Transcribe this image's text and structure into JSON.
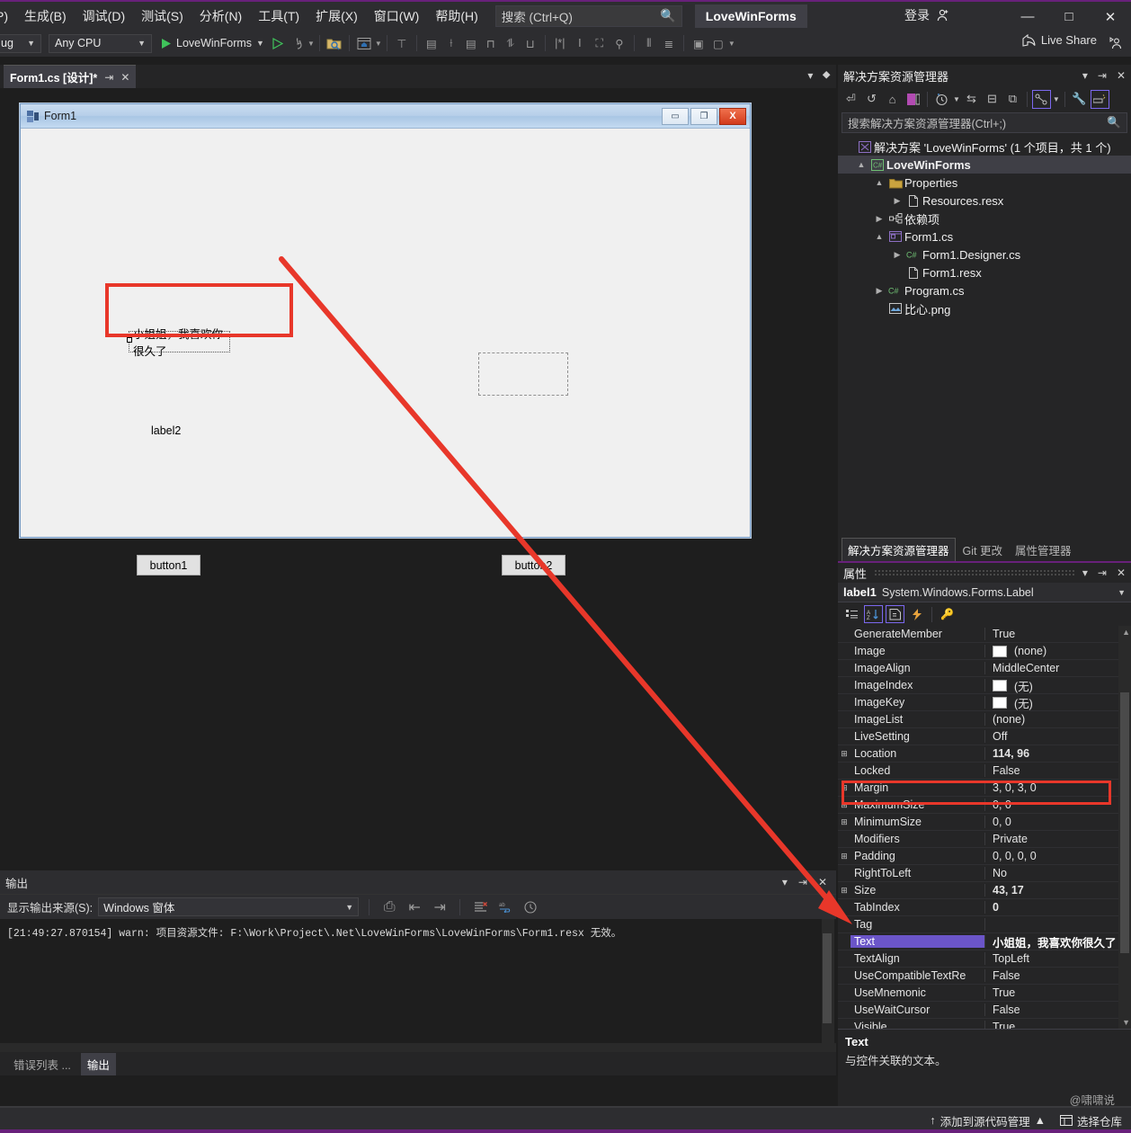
{
  "menu": {
    "items": [
      "P)",
      "生成(B)",
      "调试(D)",
      "测试(S)",
      "分析(N)",
      "工具(T)",
      "扩展(X)",
      "窗口(W)",
      "帮助(H)"
    ],
    "search_placeholder": "搜索 (Ctrl+Q)",
    "project_chip": "LoveWinForms",
    "login_label": "登录",
    "minimize": "—",
    "maximize": "□",
    "close": "✕"
  },
  "toolbar": {
    "config": "ug",
    "platform": "Any CPU",
    "run_target": "LoveWinForms",
    "live_share": "Live Share"
  },
  "doctab": {
    "title": "Form1.cs [设计]*",
    "pin": "⇥",
    "close": "✕"
  },
  "designer": {
    "form_title": "Form1",
    "minimize": "▭",
    "maximize": "❐",
    "close": "X",
    "label1_text": "小姐姐，我喜欢你很久了",
    "label2_text": "label2",
    "button1_text": "button1",
    "button2_text": "button2"
  },
  "solution_explorer": {
    "title": "解决方案资源管理器",
    "search_placeholder": "搜索解决方案资源管理器(Ctrl+;)",
    "tree": [
      {
        "indent": 0,
        "twisty": "",
        "icon": "solution-icon",
        "label": "解决方案 'LoveWinForms' (1 个项目，共 1 个)",
        "bold": false,
        "selected": false
      },
      {
        "indent": 1,
        "twisty": "▲",
        "icon": "csproj-icon",
        "label": "LoveWinForms",
        "bold": true,
        "selected": true
      },
      {
        "indent": 2,
        "twisty": "▲",
        "icon": "folder-icon",
        "label": "Properties",
        "bold": false,
        "selected": false
      },
      {
        "indent": 3,
        "twisty": "▶",
        "icon": "resx-icon",
        "label": "Resources.resx",
        "bold": false,
        "selected": false
      },
      {
        "indent": 2,
        "twisty": "▶",
        "icon": "deps-icon",
        "label": "依赖项",
        "bold": false,
        "selected": false
      },
      {
        "indent": 2,
        "twisty": "▲",
        "icon": "form-icon",
        "label": "Form1.cs",
        "bold": false,
        "selected": false
      },
      {
        "indent": 3,
        "twisty": "▶",
        "icon": "cs-icon",
        "label": "Form1.Designer.cs",
        "bold": false,
        "selected": false
      },
      {
        "indent": 3,
        "twisty": "",
        "icon": "resx-icon",
        "label": "Form1.resx",
        "bold": false,
        "selected": false
      },
      {
        "indent": 2,
        "twisty": "▶",
        "icon": "cs-icon",
        "label": "Program.cs",
        "bold": false,
        "selected": false
      },
      {
        "indent": 2,
        "twisty": "",
        "icon": "image-icon",
        "label": "比心.png",
        "bold": false,
        "selected": false
      }
    ]
  },
  "panel_tabs": [
    {
      "label": "解决方案资源管理器",
      "active": true
    },
    {
      "label": "Git 更改",
      "active": false
    },
    {
      "label": "属性管理器",
      "active": false
    }
  ],
  "properties": {
    "title": "属性",
    "object_name": "label1",
    "object_type": "System.Windows.Forms.Label",
    "rows": [
      {
        "expand": "",
        "name": "GenerateMember",
        "value": "True",
        "swatch": false,
        "bold": false,
        "selected": false
      },
      {
        "expand": "",
        "name": "Image",
        "value": "(none)",
        "swatch": true,
        "bold": false,
        "selected": false
      },
      {
        "expand": "",
        "name": "ImageAlign",
        "value": "MiddleCenter",
        "swatch": false,
        "bold": false,
        "selected": false
      },
      {
        "expand": "",
        "name": "ImageIndex",
        "value": "(无)",
        "swatch": true,
        "bold": false,
        "selected": false
      },
      {
        "expand": "",
        "name": "ImageKey",
        "value": "(无)",
        "swatch": true,
        "bold": false,
        "selected": false
      },
      {
        "expand": "",
        "name": "ImageList",
        "value": "(none)",
        "swatch": false,
        "bold": false,
        "selected": false
      },
      {
        "expand": "",
        "name": "LiveSetting",
        "value": "Off",
        "swatch": false,
        "bold": false,
        "selected": false
      },
      {
        "expand": "⊞",
        "name": "Location",
        "value": "114, 96",
        "swatch": false,
        "bold": true,
        "selected": false
      },
      {
        "expand": "",
        "name": "Locked",
        "value": "False",
        "swatch": false,
        "bold": false,
        "selected": false
      },
      {
        "expand": "⊞",
        "name": "Margin",
        "value": "3, 0, 3, 0",
        "swatch": false,
        "bold": false,
        "selected": false
      },
      {
        "expand": "⊞",
        "name": "MaximumSize",
        "value": "0, 0",
        "swatch": false,
        "bold": false,
        "selected": false
      },
      {
        "expand": "⊞",
        "name": "MinimumSize",
        "value": "0, 0",
        "swatch": false,
        "bold": false,
        "selected": false
      },
      {
        "expand": "",
        "name": "Modifiers",
        "value": "Private",
        "swatch": false,
        "bold": false,
        "selected": false
      },
      {
        "expand": "⊞",
        "name": "Padding",
        "value": "0, 0, 0, 0",
        "swatch": false,
        "bold": false,
        "selected": false
      },
      {
        "expand": "",
        "name": "RightToLeft",
        "value": "No",
        "swatch": false,
        "bold": false,
        "selected": false
      },
      {
        "expand": "⊞",
        "name": "Size",
        "value": "43, 17",
        "swatch": false,
        "bold": true,
        "selected": false
      },
      {
        "expand": "",
        "name": "TabIndex",
        "value": "0",
        "swatch": false,
        "bold": true,
        "selected": false
      },
      {
        "expand": "",
        "name": "Tag",
        "value": "",
        "swatch": false,
        "bold": false,
        "selected": false
      },
      {
        "expand": "",
        "name": "Text",
        "value": "小姐姐，我喜欢你很久了",
        "swatch": false,
        "bold": true,
        "selected": true
      },
      {
        "expand": "",
        "name": "TextAlign",
        "value": "TopLeft",
        "swatch": false,
        "bold": false,
        "selected": false
      },
      {
        "expand": "",
        "name": "UseCompatibleTextRe",
        "value": "False",
        "swatch": false,
        "bold": false,
        "selected": false
      },
      {
        "expand": "",
        "name": "UseMnemonic",
        "value": "True",
        "swatch": false,
        "bold": false,
        "selected": false
      },
      {
        "expand": "",
        "name": "UseWaitCursor",
        "value": "False",
        "swatch": false,
        "bold": false,
        "selected": false
      },
      {
        "expand": "",
        "name": "Visible",
        "value": "True",
        "swatch": false,
        "bold": false,
        "selected": false
      }
    ],
    "desc_title": "Text",
    "desc_body": "与控件关联的文本。"
  },
  "output": {
    "title": "输出",
    "source_label": "显示输出来源(S):",
    "source_value": "Windows 窗体",
    "log_line": "[21:49:27.870154] warn: 项目资源文件: F:\\Work\\Project\\.Net\\LoveWinForms\\LoveWinForms\\Form1.resx 无效。",
    "tabs": [
      {
        "label": "错误列表 ...",
        "active": false
      },
      {
        "label": "输出",
        "active": true
      }
    ]
  },
  "statusbar": {
    "add_to_source_control": "添加到源代码管理",
    "select_repo": "选择仓库",
    "watermark": "@啸啸说"
  },
  "colors": {
    "accent_purple": "#68217a",
    "annotation_red": "#e8372a",
    "selection_blue": "#6b55c8",
    "vs_dark_bg": "#1e1e1e",
    "panel_bg": "#252526",
    "chrome_bg": "#2d2d30"
  }
}
